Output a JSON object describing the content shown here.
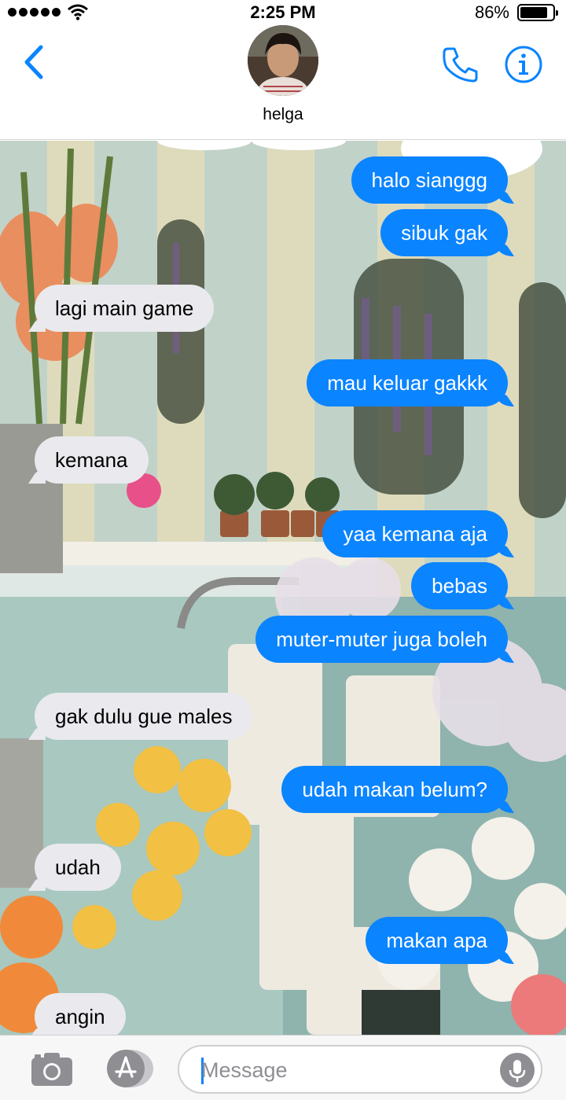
{
  "status_bar": {
    "time": "2:25 PM",
    "battery_percent": "86%",
    "battery_level": 0.86,
    "signal_bars": 5
  },
  "header": {
    "contact_name": "helga",
    "back_icon": "chevron-left-icon",
    "call_icon": "phone-icon",
    "info_icon": "info-icon"
  },
  "messages": [
    {
      "text": "halo sianggg",
      "direction": "sent"
    },
    {
      "text": "sibuk gak",
      "direction": "sent"
    },
    {
      "text": "lagi main game",
      "direction": "received"
    },
    {
      "text": "mau keluar gakkk",
      "direction": "sent"
    },
    {
      "text": "kemana",
      "direction": "received"
    },
    {
      "text": "yaa kemana aja",
      "direction": "sent"
    },
    {
      "text": "bebas",
      "direction": "sent"
    },
    {
      "text": "muter-muter juga boleh",
      "direction": "sent"
    },
    {
      "text": "gak dulu gue males",
      "direction": "received"
    },
    {
      "text": "udah makan belum?",
      "direction": "sent"
    },
    {
      "text": "udah",
      "direction": "received"
    },
    {
      "text": "makan apa",
      "direction": "sent"
    },
    {
      "text": "angin",
      "direction": "received"
    }
  ],
  "input_bar": {
    "placeholder": "Message",
    "camera_icon": "camera-icon",
    "apps_icon": "app-store-icon",
    "mic_icon": "microphone-icon"
  },
  "colors": {
    "accent": "#0b84ff",
    "received_bubble": "#e9e9ee"
  }
}
